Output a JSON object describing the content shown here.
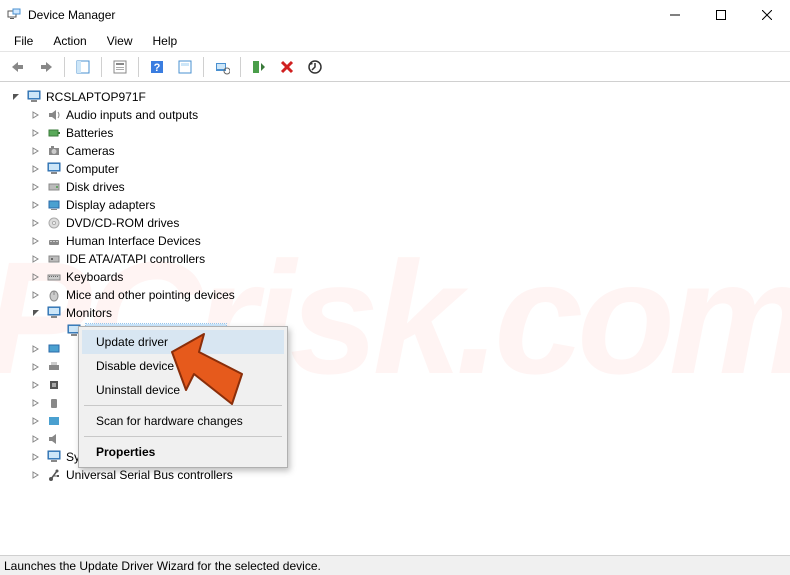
{
  "window": {
    "title": "Device Manager"
  },
  "menubar": {
    "file": "File",
    "action": "Action",
    "view": "View",
    "help": "Help"
  },
  "tree": {
    "root": "RCSLAPTOP971F",
    "items": [
      "Audio inputs and outputs",
      "Batteries",
      "Cameras",
      "Computer",
      "Disk drives",
      "Display adapters",
      "DVD/CD-ROM drives",
      "Human Interface Devices",
      "IDE ATA/ATAPI controllers",
      "Keyboards",
      "Mice and other pointing devices",
      "Monitors"
    ],
    "monitors_child_placeholder": " ",
    "tail_items": [
      " ",
      " ",
      " ",
      " ",
      " ",
      " ",
      "System devices",
      "Universal Serial Bus controllers"
    ]
  },
  "context_menu": {
    "update": "Update driver",
    "disable": "Disable device",
    "uninstall": "Uninstall device",
    "scan": "Scan for hardware changes",
    "properties": "Properties"
  },
  "statusbar": {
    "text": "Launches the Update Driver Wizard for the selected device."
  },
  "watermark": "PCrisk.com"
}
